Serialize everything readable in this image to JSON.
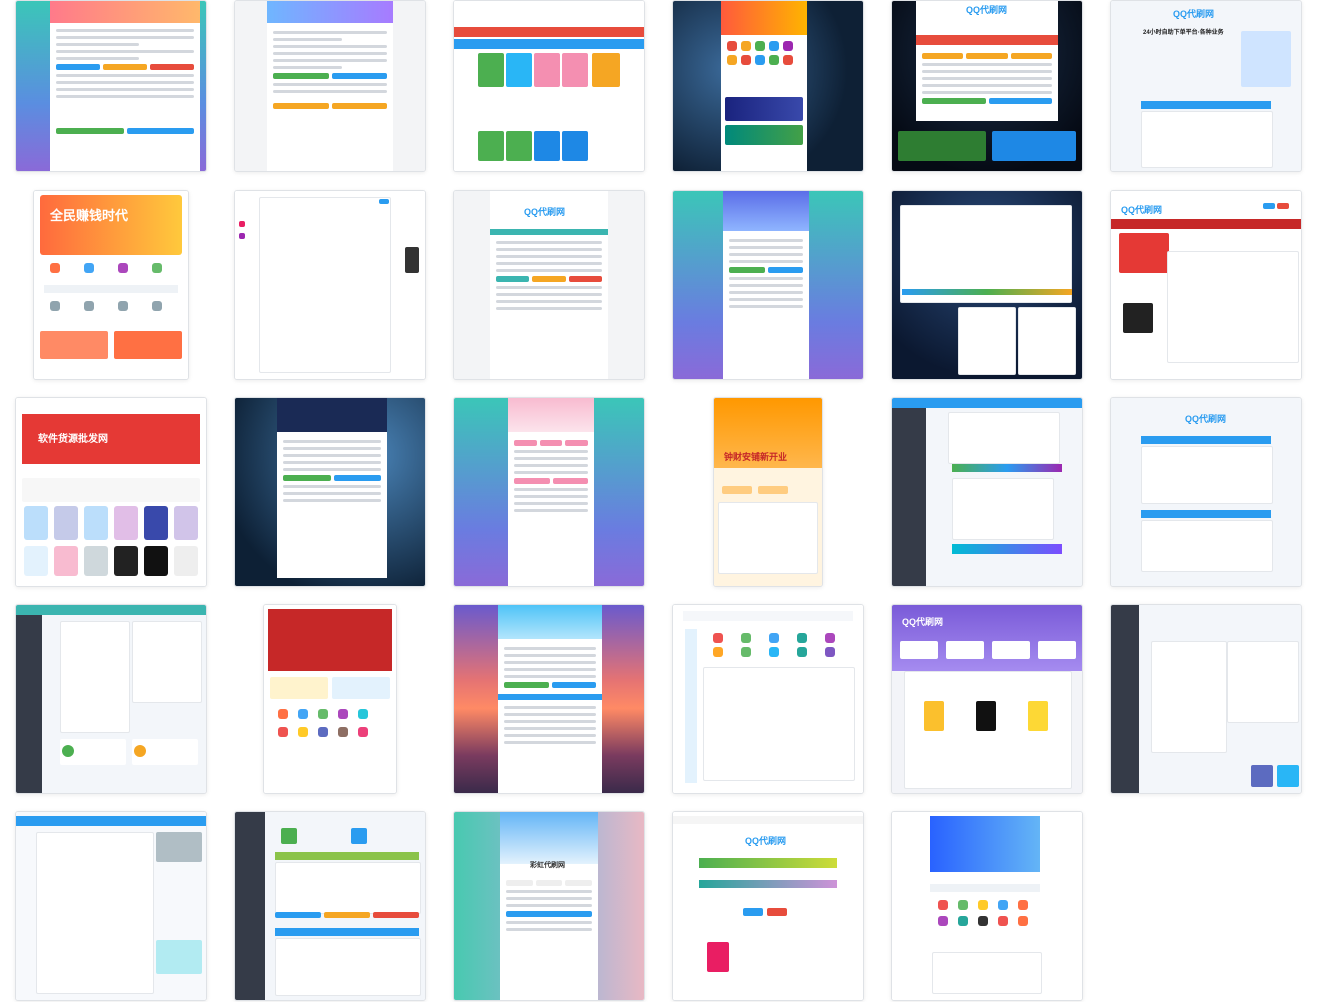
{
  "gallery": {
    "title": "",
    "cards": [
      {
        "id": 1,
        "logo": "",
        "caption": ""
      },
      {
        "id": 2,
        "logo": "",
        "caption": ""
      },
      {
        "id": 3,
        "logo": "",
        "caption": ""
      },
      {
        "id": 4,
        "logo": "",
        "caption": ""
      },
      {
        "id": 5,
        "logo": "QQ代刷网",
        "caption": ""
      },
      {
        "id": 6,
        "logo": "QQ代刷网",
        "headline": "24小时自助下单平台·各种业务",
        "caption": ""
      },
      {
        "id": 7,
        "logo": "",
        "headline": "全民赚钱时代",
        "caption": ""
      },
      {
        "id": 8,
        "logo": "",
        "caption": ""
      },
      {
        "id": 9,
        "logo": "QQ代刷网",
        "caption": ""
      },
      {
        "id": 10,
        "logo": "",
        "caption": ""
      },
      {
        "id": 11,
        "logo": "",
        "caption": ""
      },
      {
        "id": 12,
        "logo": "QQ代刷网",
        "caption": ""
      },
      {
        "id": 13,
        "logo": "",
        "headline": "软件货源批发网",
        "caption": ""
      },
      {
        "id": 14,
        "logo": "",
        "caption": ""
      },
      {
        "id": 15,
        "logo": "",
        "caption": ""
      },
      {
        "id": 16,
        "logo": "",
        "headline": "钟财安铺新开业",
        "caption": ""
      },
      {
        "id": 17,
        "logo": "",
        "caption": ""
      },
      {
        "id": 18,
        "logo": "QQ代刷网",
        "caption": ""
      },
      {
        "id": 19,
        "logo": "",
        "caption": ""
      },
      {
        "id": 20,
        "logo": "",
        "caption": ""
      },
      {
        "id": 21,
        "logo": "",
        "caption": ""
      },
      {
        "id": 22,
        "logo": "",
        "caption": ""
      },
      {
        "id": 23,
        "logo": "QQ代刷网",
        "caption": ""
      },
      {
        "id": 24,
        "logo": "",
        "caption": ""
      },
      {
        "id": 25,
        "logo": "",
        "caption": ""
      },
      {
        "id": 26,
        "logo": "",
        "caption": ""
      },
      {
        "id": 27,
        "logo": "",
        "headline": "彩虹代刷网",
        "caption": ""
      },
      {
        "id": 28,
        "logo": "QQ代刷网",
        "caption": ""
      },
      {
        "id": 29,
        "logo": "",
        "caption": ""
      }
    ]
  },
  "colors": {
    "accent_blue": "#2a9cf0",
    "red": "#e74c3c",
    "green": "#4caf50",
    "orange": "#f5a623",
    "purple": "#7a5bd8",
    "teal": "#3bb5b0",
    "dark_sidebar": "#353b48"
  }
}
